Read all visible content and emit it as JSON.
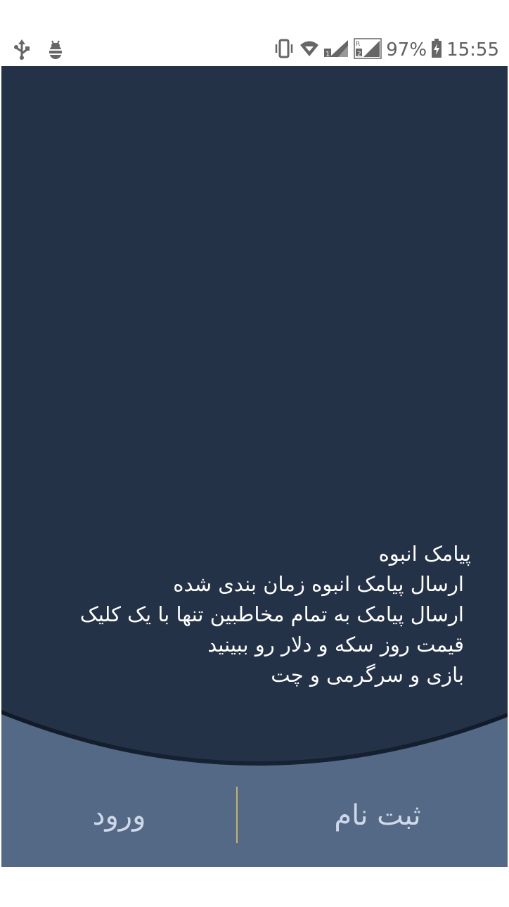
{
  "status_bar": {
    "battery_percent": "97%",
    "time": "15:55",
    "icons": [
      "usb-icon",
      "bug-icon",
      "vibrate-icon",
      "wifi-icon",
      "signal-sim1-icon",
      "signal-sim2-roaming-icon",
      "battery-charging-icon"
    ]
  },
  "main": {
    "features": {
      "title": "پیامک انبوه",
      "items": [
        "ارسال پیامک انبوه زمان بندی شده",
        "ارسال پیامک به تمام مخاطبین تنها با یک کلیک",
        "قیمت روز سکه و دلار رو ببینید",
        "بازی و سرگرمی و چت"
      ]
    }
  },
  "buttons": {
    "login_label": "ورود",
    "register_label": "ثبت نام"
  },
  "colors": {
    "background_dark": "#233247",
    "bottom_panel": "#536985",
    "divider": "#c9b36a"
  }
}
